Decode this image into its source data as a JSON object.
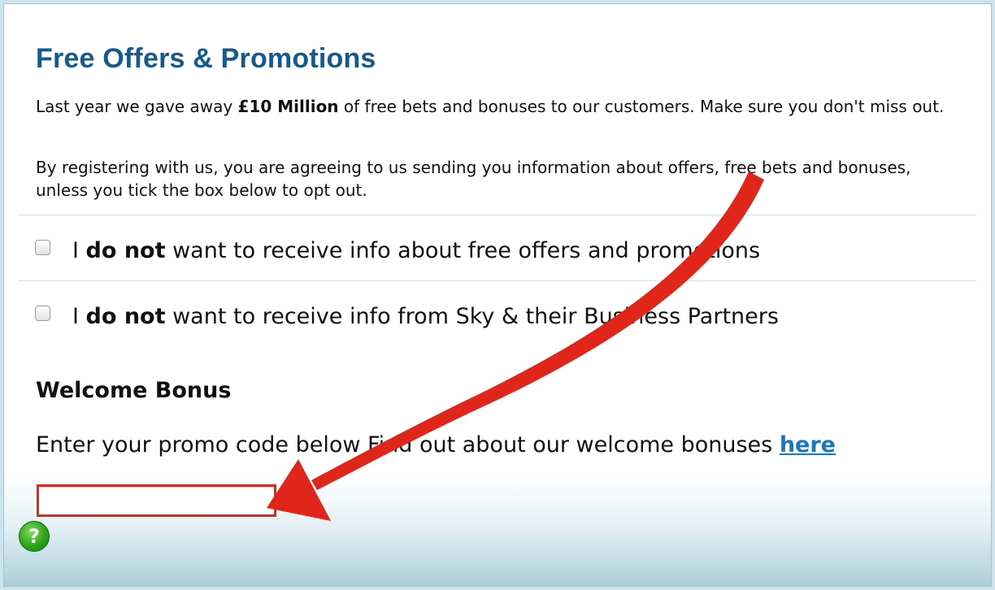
{
  "page": {
    "title": "Free Offers & Promotions",
    "intro": {
      "prefix": "Last year we gave away ",
      "bold": "£10 Million",
      "suffix": " of free bets and bonuses to our customers. Make sure you don't miss out."
    },
    "consent_text": "By registering with us, you are agreeing to us sending you information about offers, free bets and bonuses, unless you tick the box below to opt out."
  },
  "options": [
    {
      "prefix": "I ",
      "bold": "do not",
      "suffix": " want to receive info about free offers and promotions",
      "checked": false
    },
    {
      "prefix": "I ",
      "bold": "do not",
      "suffix": " want to receive info from Sky & their Business Partners",
      "checked": false
    }
  ],
  "welcome": {
    "heading": "Welcome Bonus",
    "line": "Enter your promo code below Find out about our welcome bonuses ",
    "link": "here",
    "promo_value": ""
  },
  "help": {
    "symbol": "?"
  },
  "colors": {
    "title": "#145a8c",
    "link": "#1679c3",
    "annotation_arrow": "#e0261a",
    "help_icon": "#2ea31d"
  }
}
